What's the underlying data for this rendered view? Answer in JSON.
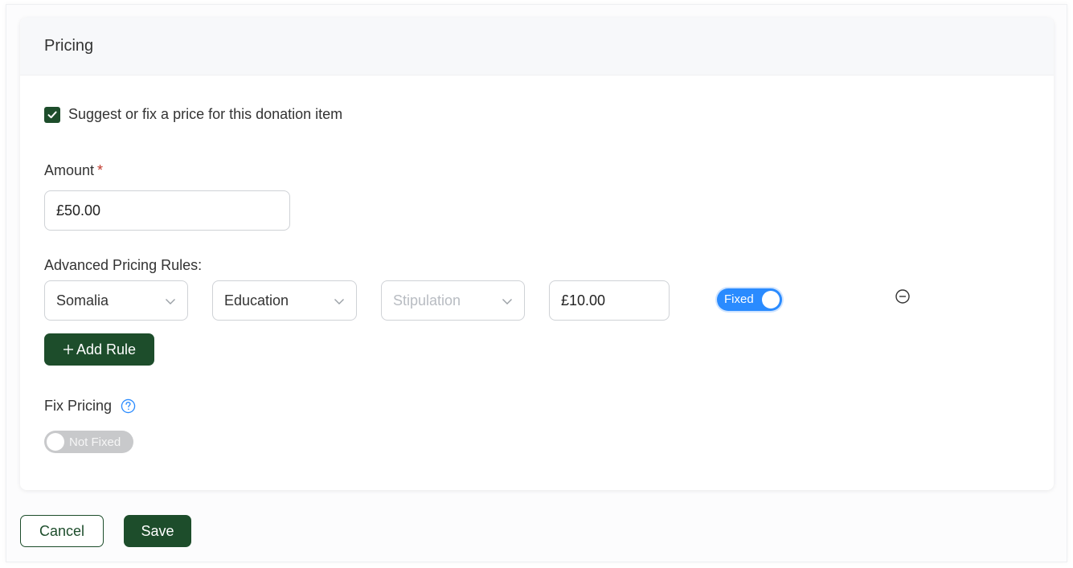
{
  "pricing": {
    "title": "Pricing",
    "suggest_checkbox": {
      "label": "Suggest or fix a price for this donation item",
      "checked": true
    },
    "amount": {
      "label": "Amount",
      "required_mark": "*",
      "value": "£50.00"
    },
    "advanced_rules": {
      "label": "Advanced Pricing Rules:",
      "rules": [
        {
          "country": "Somalia",
          "category": "Education",
          "stipulation_placeholder": "Stipulation",
          "amount": "£10.00",
          "toggle_label": "Fixed",
          "toggle_on": true
        }
      ],
      "add_rule_label": "Add Rule"
    },
    "fix_pricing": {
      "label": "Fix Pricing",
      "toggle_label": "Not Fixed",
      "toggle_on": false
    }
  },
  "footer": {
    "cancel_label": "Cancel",
    "save_label": "Save"
  },
  "colors": {
    "primary": "#1d4d2b",
    "toggle_on": "#2a8bff",
    "required": "#c0392b",
    "help": "#2a8bff"
  },
  "icons": {
    "checkbox": "check-icon",
    "select": "chevron-down-icon",
    "remove": "minus-circle-icon",
    "add": "plus-icon",
    "help": "question-circle-icon"
  }
}
